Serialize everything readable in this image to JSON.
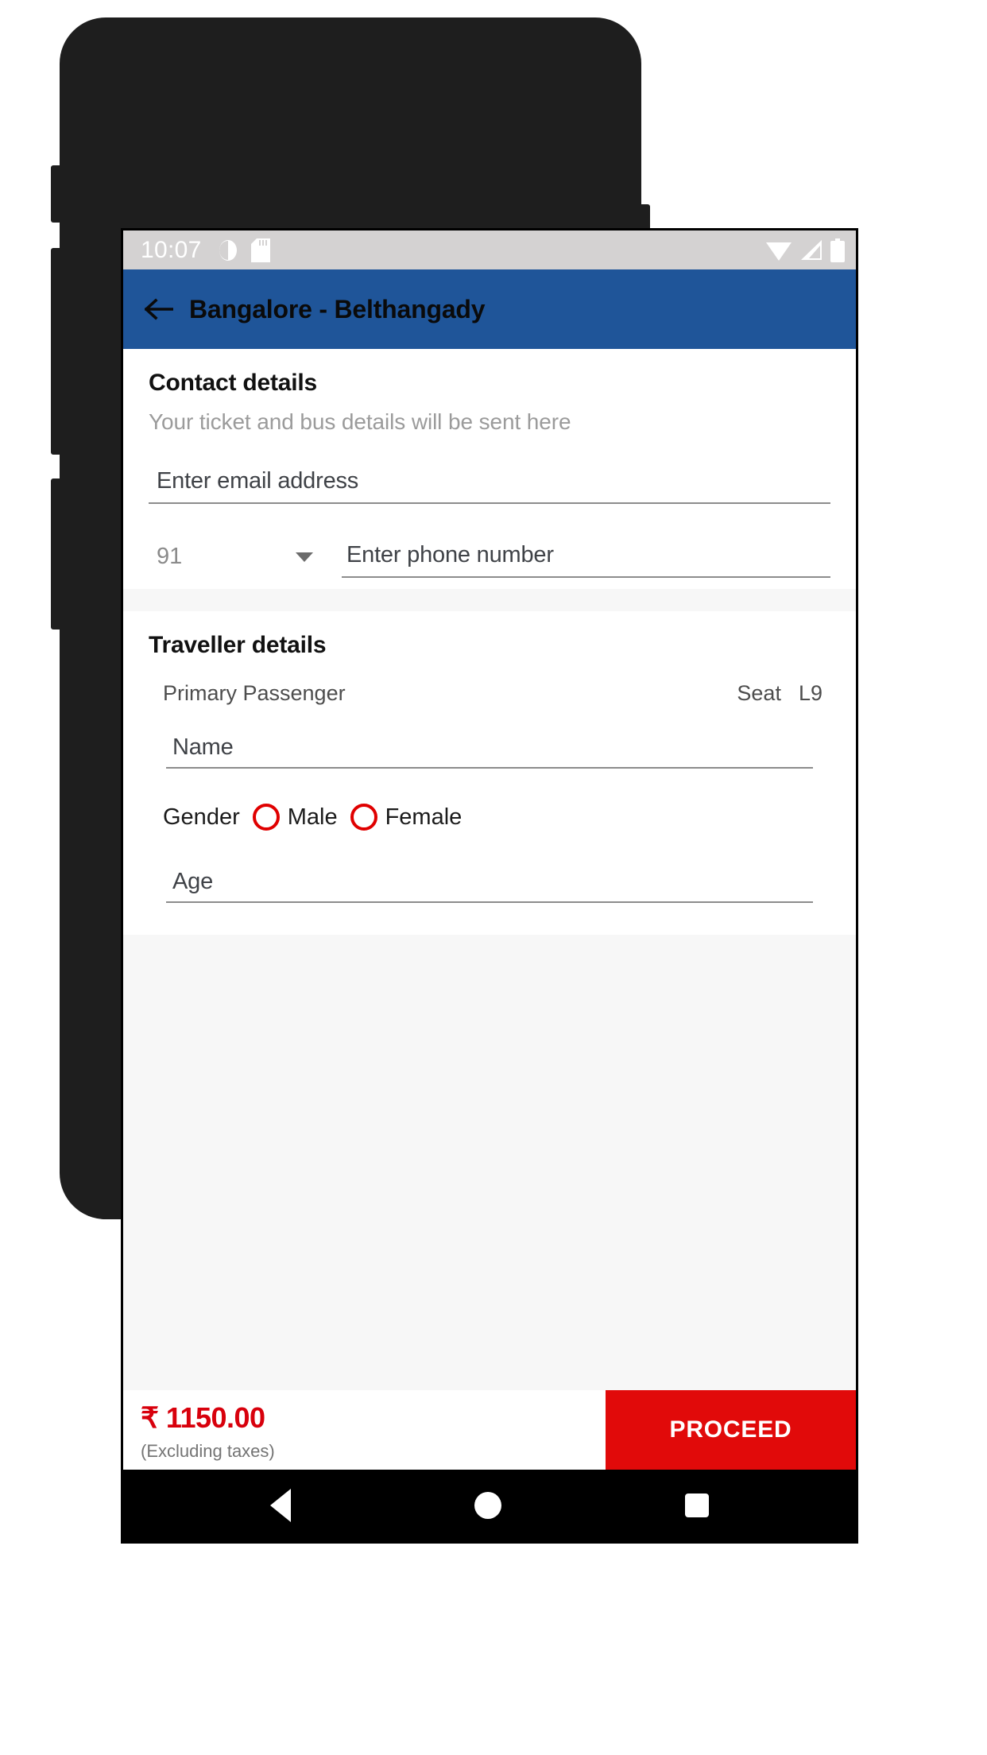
{
  "statusbar": {
    "clock": "10:07",
    "icons_left": [
      "vibrate-icon",
      "sd-card-icon"
    ],
    "icons_right": [
      "wifi-icon",
      "signal-icon",
      "battery-icon"
    ]
  },
  "appbar": {
    "back_icon": "back-arrow-icon",
    "title": "Bangalore - Belthangady",
    "background": "#1f5599"
  },
  "contact": {
    "title": "Contact details",
    "subtitle": "Your ticket and bus details will be sent here",
    "email": {
      "value": "",
      "placeholder": "Enter email address"
    },
    "country_code": {
      "selected": "91",
      "caret_icon": "chevron-down-icon"
    },
    "phone": {
      "value": "",
      "placeholder": "Enter phone number"
    }
  },
  "traveller": {
    "title": "Traveller details",
    "passenger_label": "Primary Passenger",
    "seat_label": "Seat",
    "seat_number": "L9",
    "name": {
      "value": "",
      "placeholder": "Name"
    },
    "gender": {
      "label": "Gender",
      "options": [
        "Male",
        "Female"
      ],
      "selected": "",
      "accent": "#e00000"
    },
    "age": {
      "value": "",
      "placeholder": "Age"
    }
  },
  "bottombar": {
    "price": "₹ 1150.00",
    "price_note": "(Excluding taxes)",
    "proceed_label": "PROCEED",
    "proceed_color": "#e10a0a",
    "price_color": "#d8000c"
  },
  "navbar": {
    "back": "nav-back-icon",
    "home": "nav-home-icon",
    "recent": "nav-recent-icon"
  }
}
